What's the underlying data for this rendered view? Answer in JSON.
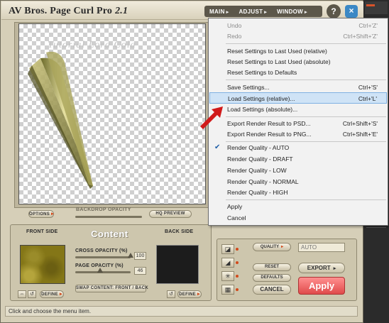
{
  "app": {
    "title": "AV Bros. Page Curl Pro",
    "version": "2.1"
  },
  "menubar": {
    "items": [
      {
        "label": "MAIN",
        "arrow": "▸"
      },
      {
        "label": "ADJUST",
        "arrow": "▸"
      },
      {
        "label": "WINDOW",
        "arrow": "▸"
      }
    ],
    "help_label": "?",
    "close_label": "×"
  },
  "preview": {
    "watermark": "Tutorial Lora Cola"
  },
  "preview_controls": {
    "options_label": "OPTIONS",
    "backdrop_opacity_label": "BACKDROP OPACITY",
    "hq_preview_label": "HQ PREVIEW"
  },
  "content_panel": {
    "title": "Content",
    "front_side_label": "FRONT SIDE",
    "back_side_label": "BACK SIDE",
    "cross_opacity_label": "CROSS OPACITY (%)",
    "cross_opacity_value": "100",
    "page_opacity_label": "PAGE OPACITY (%)",
    "page_opacity_value": "46",
    "swap_label": "SWAP CONTENT: FRONT / BACK",
    "define_front_label": "DEFINE",
    "define_back_label": "DEFINE",
    "swap_icon_glyph": "⇔",
    "reset_icon_glyph": "↺"
  },
  "render_panel": {
    "quality_label": "QUALITY",
    "quality_value": "AUTO",
    "reset_label": "RESET",
    "defaults_label": "DEFAULTS",
    "cancel_label": "CANCEL",
    "export_label": "EXPORT",
    "apply_label": "Apply"
  },
  "status": {
    "text": "Click and choose the menu item."
  },
  "menu": {
    "items": [
      {
        "label": "Undo",
        "shortcut": "Ctrl+'Z'",
        "enabled": false
      },
      {
        "label": "Redo",
        "shortcut": "Ctrl+Shift+'Z'",
        "enabled": false
      },
      {
        "label": "Reset Settings to Last Used (relative)",
        "shortcut": ""
      },
      {
        "label": "Reset Settings to Last Used (absolute)",
        "shortcut": ""
      },
      {
        "label": "Reset Settings to Defaults",
        "shortcut": ""
      },
      {
        "label": "Save Settings...",
        "shortcut": "Ctrl+'S'"
      },
      {
        "label": "Load Settings (relative)...",
        "shortcut": "Ctrl+'L'",
        "highlighted": true
      },
      {
        "label": "Load Settings (absolute)...",
        "shortcut": ""
      },
      {
        "label": "Export Render Result to PSD...",
        "shortcut": "Ctrl+Shift+'S'"
      },
      {
        "label": "Export Render Result to PNG...",
        "shortcut": "Ctrl+Shift+'E'"
      },
      {
        "label": "Render Quality - AUTO",
        "shortcut": "",
        "checked": true
      },
      {
        "label": "Render Quality - DRAFT",
        "shortcut": ""
      },
      {
        "label": "Render Quality - LOW",
        "shortcut": ""
      },
      {
        "label": "Render Quality - NORMAL",
        "shortcut": ""
      },
      {
        "label": "Render Quality - HIGH",
        "shortcut": ""
      },
      {
        "label": "Apply",
        "shortcut": ""
      },
      {
        "label": "Cancel",
        "shortcut": ""
      }
    ],
    "check_glyph": "✔"
  },
  "colors": {
    "panel": "#d6cfb8",
    "menu_highlight": "#cfe3f6",
    "apply": "#e85a5a",
    "accent_dot": "#d24a1c",
    "pointer_arrow": "#d11a1a"
  }
}
